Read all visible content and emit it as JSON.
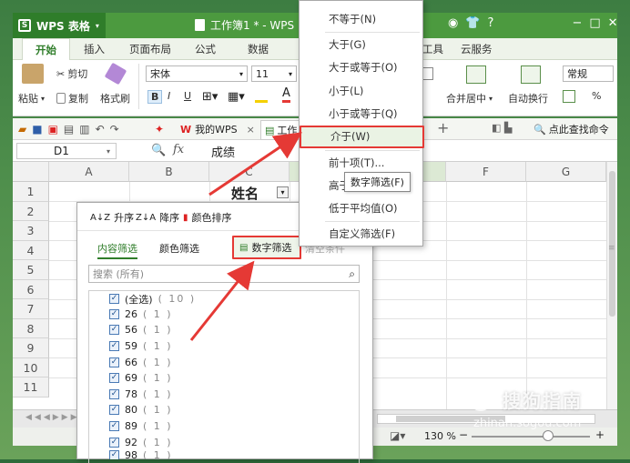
{
  "app": {
    "logo": "WPS 表格",
    "doc_title": "工作簿1 * - WPS"
  },
  "title_icons": [
    "?",
    "−",
    "□"
  ],
  "ribbon_tabs": [
    "开始",
    "插入",
    "页面布局",
    "公式",
    "数据",
    "工具",
    "云服务"
  ],
  "ribbon": {
    "paste": "粘贴",
    "cut": "剪切",
    "copy": "复制",
    "format_painter": "格式刷",
    "font_name": "宋体",
    "font_size": "11",
    "bold": "B",
    "italic": "I",
    "underline": "U",
    "merge_center": "合并居中",
    "wrap_text": "自动换行",
    "number_format": "常规",
    "percent": "%"
  },
  "quickbar": {
    "tab_mywps": "我的WPS",
    "tab_workbook": "工作",
    "close_x": "×",
    "plus": "+",
    "search": "点此查找命令"
  },
  "formula": {
    "cell_ref": "D1",
    "fx": "fx",
    "value": "成绩"
  },
  "columns": [
    "A",
    "B",
    "C",
    "",
    "F",
    "G"
  ],
  "rows": [
    "1",
    "2",
    "3",
    "4",
    "5",
    "6",
    "7",
    "8",
    "9",
    "10",
    "11"
  ],
  "cell_c1": "姓名",
  "filter_panel": {
    "sort_asc": "升序",
    "sort_desc": "降序",
    "sort_color": "颜色排序",
    "tab_content": "内容筛选",
    "tab_color": "颜色筛选",
    "tab_number": "数字筛选",
    "clear": "清空条件",
    "search_placeholder": "搜索 (所有)",
    "items": [
      {
        "label": "(全选)",
        "count": "( 10 )"
      },
      {
        "label": "26",
        "count": "( 1 )"
      },
      {
        "label": "56",
        "count": "( 1 )"
      },
      {
        "label": "59",
        "count": "( 1 )"
      },
      {
        "label": "66",
        "count": "( 1 )"
      },
      {
        "label": "69",
        "count": "( 1 )"
      },
      {
        "label": "78",
        "count": "( 1 )"
      },
      {
        "label": "80",
        "count": "( 1 )"
      },
      {
        "label": "89",
        "count": "( 1 )"
      },
      {
        "label": "92",
        "count": "( 1 )"
      },
      {
        "label": "98",
        "count": "( 1 )"
      }
    ]
  },
  "number_menu": {
    "items": [
      "不等于(N)",
      "大于(G)",
      "大于或等于(O)",
      "小于(L)",
      "小于或等于(Q)",
      "介于(W)",
      "前十项(T)...",
      "高于",
      "低于平均值(O)",
      "自定义筛选(F)"
    ],
    "tooltip": "数字筛选(F)"
  },
  "status": {
    "zoom": "130 %"
  },
  "watermark": {
    "brand": "搜狗指南",
    "url": "zhinan.sogou.com"
  },
  "colors": {
    "accent": "#4c9a3f",
    "highlight_red": "#e53935"
  }
}
